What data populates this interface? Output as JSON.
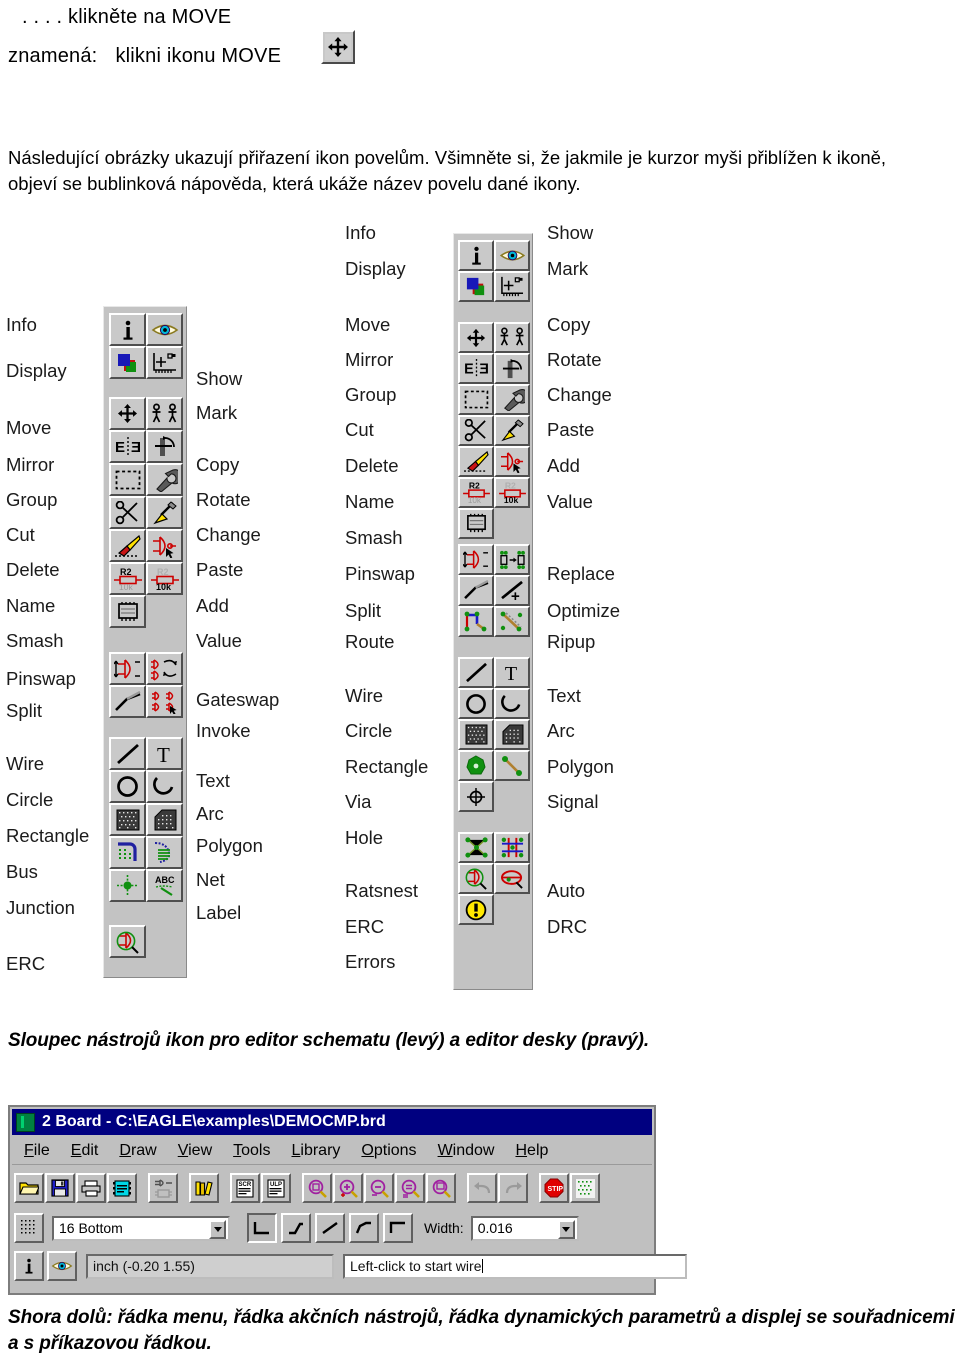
{
  "header": {
    "line1": ". . . . klikněte na MOVE",
    "line2_a": "znamená:",
    "line2_b": "klikni ikonu MOVE",
    "move_icon_name": "move-icon"
  },
  "paragraph": "Následující obrázky ukazují přiřazení ikon povelům. Všimněte si, že jakmile je kurzor myši přiblížen k ikoně, objeví se bublinková nápověda, která ukáže název povelu dané ikony.",
  "schematic_toolbar": {
    "title": "Sloupec nástrojů ikon pro editor schematu",
    "left_labels": [
      "Info",
      "Display",
      "Move",
      "Mirror",
      "Group",
      "Cut",
      "Delete",
      "Name",
      "Smash",
      "Pinswap",
      "Split",
      "Wire",
      "Circle",
      "Rectangle",
      "Bus",
      "Junction",
      "ERC"
    ],
    "right_labels": [
      "Show",
      "Mark",
      "Copy",
      "Rotate",
      "Change",
      "Paste",
      "Add",
      "Value",
      "Gateswap",
      "Invoke",
      "Text",
      "Arc",
      "Polygon",
      "Net",
      "Label"
    ],
    "rows": [
      {
        "left": "info-icon",
        "right": "display-eye-icon"
      },
      {
        "left": "layers-icon",
        "right": "grid-mark-icon"
      },
      {
        "left": "move-icon",
        "right": "copy-icon"
      },
      {
        "left": "mirror-icon",
        "right": "rotate-icon"
      },
      {
        "left": "group-icon",
        "right": "change-wrench-icon"
      },
      {
        "left": "cut-scissors-icon",
        "right": "paste-icon"
      },
      {
        "left": "delete-eraser-icon",
        "right": "add-gate-icon"
      },
      {
        "left": "name-r2-icon",
        "right": "value-10k-icon"
      },
      {
        "left": "smash-icon",
        "right": null
      },
      {
        "left": "pinswap-icon",
        "right": "gateswap-icon"
      },
      {
        "left": "split-icon",
        "right": "invoke-icon"
      },
      {
        "left": "wire-icon",
        "right": "text-icon"
      },
      {
        "left": "circle-icon",
        "right": "arc-icon"
      },
      {
        "left": "rectangle-icon",
        "right": "polygon-icon"
      },
      {
        "left": "bus-icon",
        "right": "net-icon"
      },
      {
        "left": "junction-icon",
        "right": "label-abc-icon"
      },
      {
        "left": "erc-icon",
        "right": null
      }
    ]
  },
  "board_toolbar": {
    "title": "editor desky",
    "left_labels": [
      "Info",
      "Display",
      "Move",
      "Mirror",
      "Group",
      "Cut",
      "Delete",
      "Name",
      "Smash",
      "Pinswap",
      "Split",
      "Route",
      "Wire",
      "Circle",
      "Rectangle",
      "Via",
      "Hole",
      "Ratsnest",
      "ERC",
      "Errors"
    ],
    "right_labels": [
      "Show",
      "Mark",
      "Copy",
      "Rotate",
      "Change",
      "Paste",
      "Add",
      "Value",
      "Replace",
      "Optimize",
      "Ripup",
      "Text",
      "Arc",
      "Polygon",
      "Signal",
      "Auto",
      "DRC"
    ]
  },
  "captions": {
    "figure1": "Sloupec nástrojů ikon pro editor schematu  (levý) a editor desky (pravý).",
    "figure2": "Shora dolů: řádka menu, řádka akčních nástrojů, řádka dynamických  parametrů a displej se souřadnicemi a s příkazovou řádkou."
  },
  "eagle_window": {
    "title": "2 Board - C:\\EAGLE\\examples\\DEMOCMP.brd",
    "menu": [
      {
        "pre": "",
        "hot": "F",
        "post": "ile"
      },
      {
        "pre": "",
        "hot": "E",
        "post": "dit"
      },
      {
        "pre": "",
        "hot": "D",
        "post": "raw"
      },
      {
        "pre": "",
        "hot": "V",
        "post": "iew"
      },
      {
        "pre": "",
        "hot": "T",
        "post": "ools"
      },
      {
        "pre": "",
        "hot": "L",
        "post": "ibrary"
      },
      {
        "pre": "",
        "hot": "O",
        "post": "ptions"
      },
      {
        "pre": "",
        "hot": "W",
        "post": "indow"
      },
      {
        "pre": "",
        "hot": "H",
        "post": "elp"
      }
    ],
    "action_buttons": [
      "open-folder-icon",
      "save-disk-icon",
      "print-icon",
      "cam-processor-icon",
      "separator",
      "schematic-board-icon",
      "separator",
      "library-icon",
      "separator",
      "script-scr-icon",
      "ulp-icon",
      "separator",
      "zoom-fit-icon",
      "zoom-in-icon",
      "zoom-out-icon",
      "zoom-redraw-icon",
      "zoom-select-icon",
      "separator",
      "undo-icon",
      "redo-icon",
      "separator",
      "stop-icon",
      "grid-icon"
    ],
    "params": {
      "grid_button": "grid-icon",
      "layer_value": "16 Bottom",
      "wire_bend_styles": [
        "bend-style-0",
        "bend-style-1",
        "bend-style-2",
        "bend-style-3",
        "bend-style-4"
      ],
      "wire_bend_selected_index": 0,
      "width_label": "Width:",
      "width_value": "0.016"
    },
    "status": {
      "info_button": "info-icon",
      "display_button": "display-eye-icon",
      "coordinates": "inch (-0.20 1.55)",
      "command_line": "Left-click to start wire"
    }
  },
  "colors": {
    "title_bar": "#000080",
    "window_face": "#c0c0c0",
    "toolbar_face": "#c3c3c3",
    "accent_red": "#cc0000",
    "accent_green": "#00a000",
    "accent_yellow": "#ffe000",
    "accent_blue": "#0000b0"
  }
}
